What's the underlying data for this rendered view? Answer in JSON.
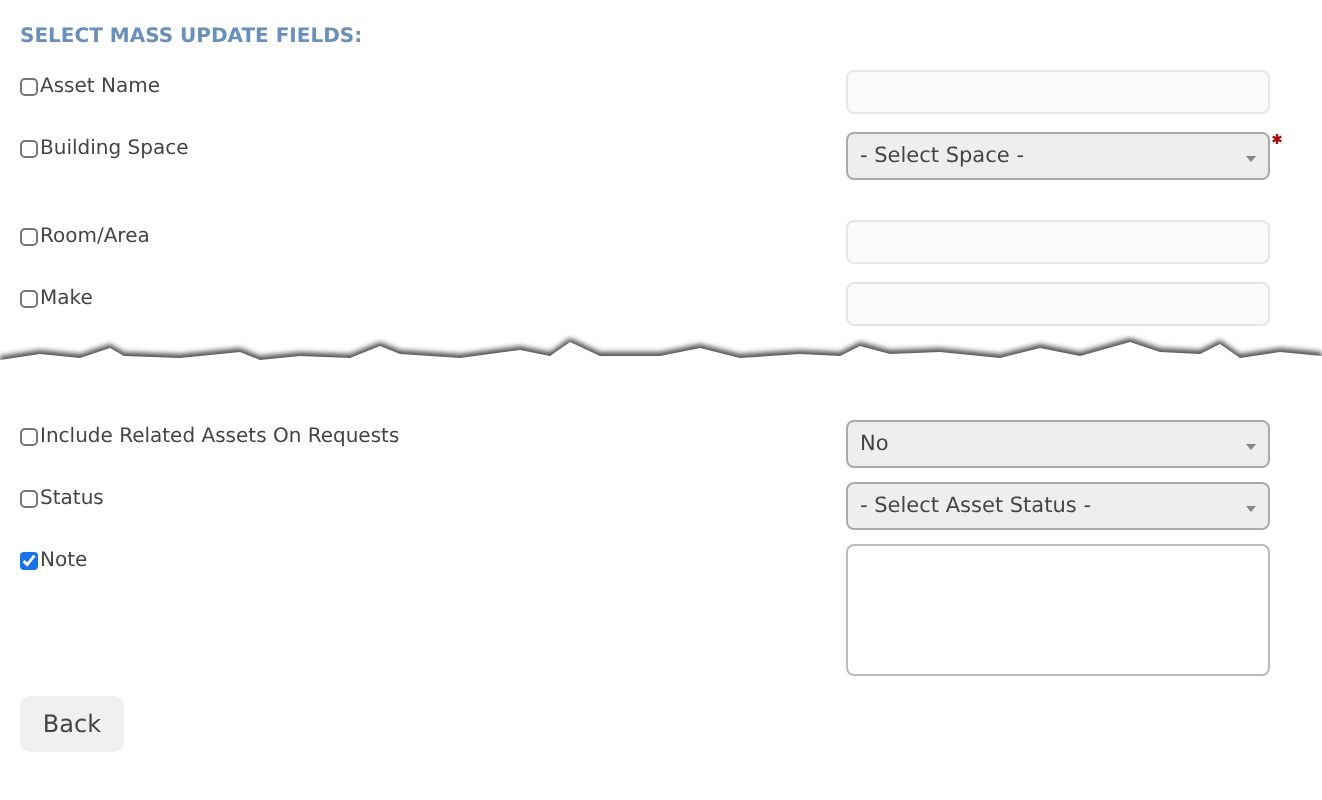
{
  "heading": "SELECT MASS UPDATE FIELDS:",
  "sections": [
    {
      "fields": [
        {
          "label": "Asset Name",
          "checked": false,
          "kind": "text"
        },
        {
          "label": "Building Space",
          "checked": false,
          "kind": "select",
          "value": "- Select Space -",
          "required": true
        },
        {
          "label": "Room/Area",
          "checked": false,
          "kind": "text"
        },
        {
          "label": "Make",
          "checked": false,
          "kind": "text"
        }
      ]
    },
    {
      "fields": [
        {
          "label": "Include Related Assets On Requests",
          "checked": false,
          "kind": "select",
          "value": "No"
        },
        {
          "label": "Status",
          "checked": false,
          "kind": "select",
          "value": "- Select Asset Status -"
        },
        {
          "label": "Note",
          "checked": true,
          "kind": "textarea"
        }
      ]
    }
  ],
  "buttons": [
    "Back"
  ]
}
